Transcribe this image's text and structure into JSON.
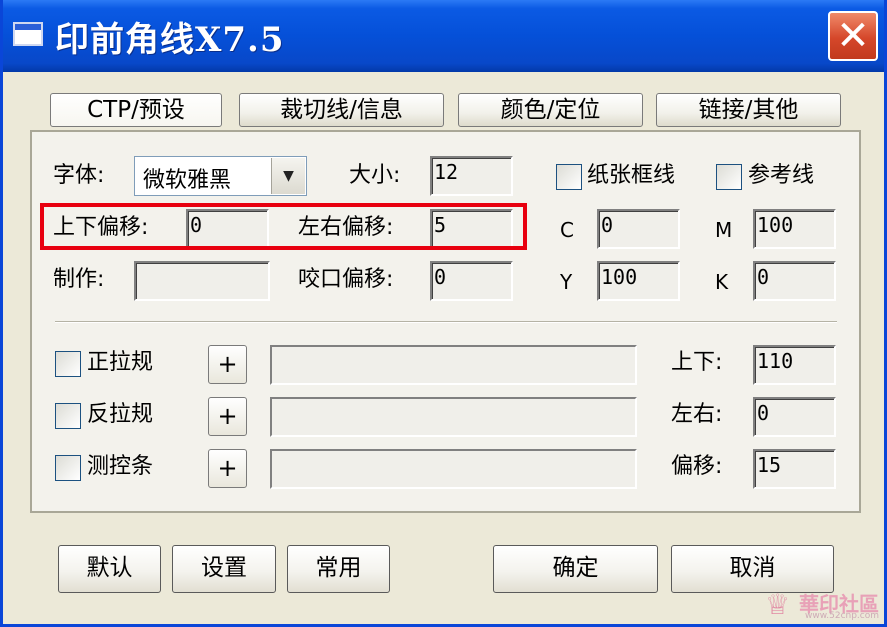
{
  "window": {
    "title": "印前角线X7.5",
    "close_label": "✕"
  },
  "tabs": [
    {
      "label": "CTP/预设"
    },
    {
      "label": "裁切线/信息"
    },
    {
      "label": "颜色/定位"
    },
    {
      "label": "链接/其他"
    }
  ],
  "font": {
    "label": "字体:",
    "value": "微软雅黑"
  },
  "size": {
    "label": "大小:",
    "value": "12"
  },
  "paper_frame": {
    "label": "纸张框线",
    "checked": false
  },
  "reference_line": {
    "label": "参考线",
    "checked": false
  },
  "offset": {
    "vertical_label": "上下偏移:",
    "vertical_value": "0",
    "horizontal_label": "左右偏移:",
    "horizontal_value": "5"
  },
  "maker": {
    "label": "制作:",
    "value": ""
  },
  "bite_offset": {
    "label": "咬口偏移:",
    "value": "0"
  },
  "cmyk": {
    "c_label": "C",
    "c_value": "0",
    "m_label": "M",
    "m_value": "100",
    "y_label": "Y",
    "y_value": "100",
    "k_label": "K",
    "k_value": "0"
  },
  "guides": [
    {
      "label": "正拉规",
      "plus": "+"
    },
    {
      "label": "反拉规",
      "plus": "+"
    },
    {
      "label": "测控条",
      "plus": "+"
    }
  ],
  "position": {
    "updown_label": "上下:",
    "updown_value": "110",
    "leftright_label": "左右:",
    "leftright_value": "0",
    "offset_label": "偏移:",
    "offset_value": "15"
  },
  "buttons": {
    "default": "默认",
    "settings": "设置",
    "common": "常用",
    "ok": "确定",
    "cancel": "取消"
  },
  "watermark": {
    "text": "華印社區",
    "url": "www.52cnp.com"
  },
  "colors": {
    "titlebar": "#0550d8",
    "highlight": "#e8000f",
    "face": "#ece9d8"
  }
}
